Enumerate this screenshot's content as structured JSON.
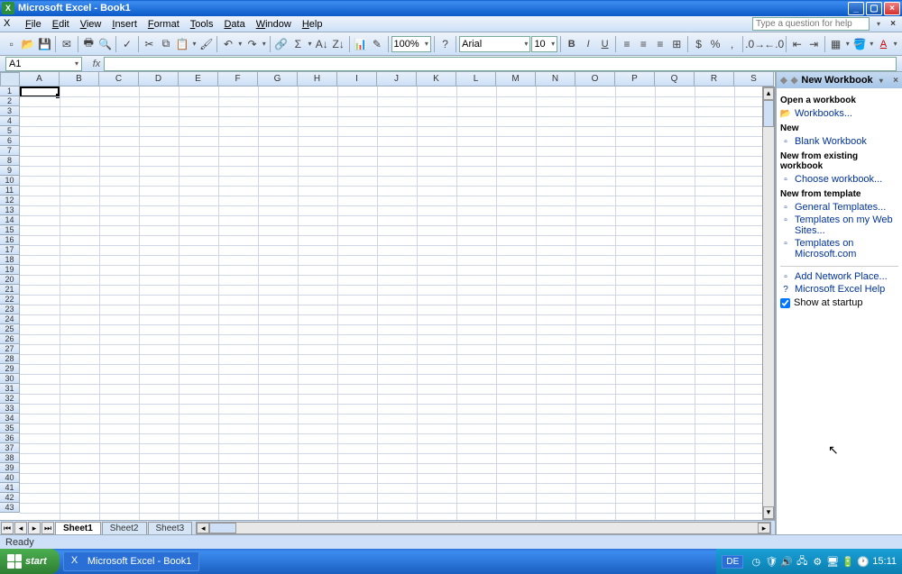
{
  "title": "Microsoft Excel - Book1",
  "menubar": [
    "File",
    "Edit",
    "View",
    "Insert",
    "Format",
    "Tools",
    "Data",
    "Window",
    "Help"
  ],
  "help_placeholder": "Type a question for help",
  "zoom": "100%",
  "font_name": "Arial",
  "font_size": "10",
  "namebox": "A1",
  "columns": [
    "A",
    "B",
    "C",
    "D",
    "E",
    "F",
    "G",
    "H",
    "I",
    "J",
    "K",
    "L",
    "M",
    "N",
    "O",
    "P",
    "Q",
    "R",
    "S"
  ],
  "rows_visible": 43,
  "sheets": [
    "Sheet1",
    "Sheet2",
    "Sheet3"
  ],
  "active_sheet": 0,
  "taskpane": {
    "title": "New Workbook",
    "sections": [
      {
        "header": "Open a workbook",
        "links": [
          {
            "icon": "📂",
            "label": "Workbooks..."
          }
        ]
      },
      {
        "header": "New",
        "links": [
          {
            "icon": "▫",
            "label": "Blank Workbook"
          }
        ]
      },
      {
        "header": "New from existing workbook",
        "links": [
          {
            "icon": "▫",
            "label": "Choose workbook..."
          }
        ]
      },
      {
        "header": "New from template",
        "links": [
          {
            "icon": "▫",
            "label": "General Templates..."
          },
          {
            "icon": "▫",
            "label": "Templates on my Web Sites..."
          },
          {
            "icon": "▫",
            "label": "Templates on Microsoft.com"
          }
        ]
      }
    ],
    "footer_links": [
      {
        "icon": "▫",
        "label": "Add Network Place..."
      },
      {
        "icon": "?",
        "label": "Microsoft Excel Help"
      }
    ],
    "checkbox": {
      "label": "Show at startup",
      "checked": true
    }
  },
  "status": "Ready",
  "taskbar_item": "Microsoft Excel - Book1",
  "lang": "DE",
  "clock": "15:11",
  "start_label": "start"
}
